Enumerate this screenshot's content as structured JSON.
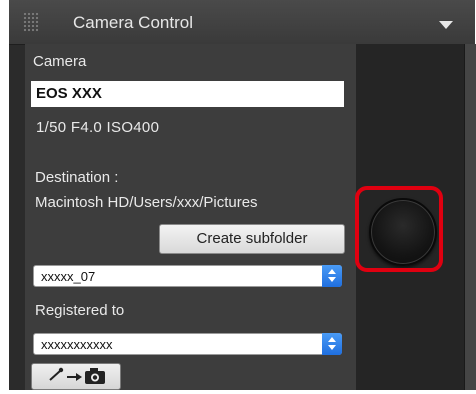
{
  "header": {
    "title": "Camera Control"
  },
  "camera": {
    "section_label": "Camera",
    "model": "EOS XXX",
    "exposure": "1/50  F4.0  ISO400"
  },
  "destination": {
    "label": "Destination :",
    "path": "Macintosh HD/Users/xxx/Pictures",
    "create_subfolder_label": "Create subfolder",
    "folder_value": "xxxxx_07"
  },
  "registered": {
    "label": "Registered to",
    "value": "xxxxxxxxxxx"
  },
  "colors": {
    "highlight": "#e00010",
    "stepper_blue": "#2f82ea"
  },
  "icons": {
    "grip": "grip-icon",
    "dropdown": "triangle-down-icon",
    "mode": "pen-camera-icon"
  }
}
